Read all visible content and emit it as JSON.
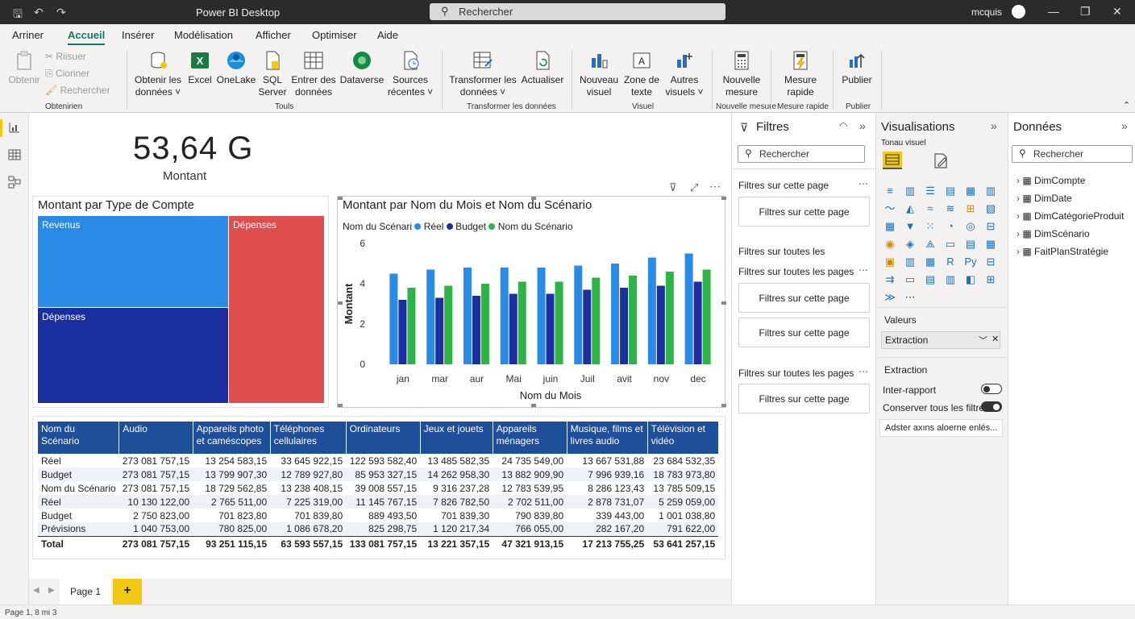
{
  "titlebar": {
    "app_title": "Power BI Desktop",
    "search_placeholder": "Rechercher",
    "user": "mcquis"
  },
  "menu": [
    "Arriner",
    "Accueil",
    "Insérer",
    "Modélisation",
    "Afficher",
    "Optimiser",
    "Aide"
  ],
  "ribbon": {
    "clipboard": {
      "paste": "Obtenir",
      "cut": "Riisuer",
      "copy": "Cioriner",
      "format": "Rechercher",
      "group": "Obtenirien"
    },
    "data": [
      {
        "line1": "Obtenir les",
        "line2": "données ˅"
      },
      {
        "line1": "Excel",
        "line2": ""
      },
      {
        "line1": "OneLake",
        "line2": ""
      },
      {
        "line1": "SQL",
        "line2": "Server"
      },
      {
        "line1": "Entrer des",
        "line2": "données"
      },
      {
        "line1": "Dataverse",
        "line2": ""
      },
      {
        "line1": "Sources",
        "line2": "récentes ˅"
      }
    ],
    "data_group": "Touls",
    "transform": [
      {
        "line1": "Transformer les",
        "line2": "données ˅"
      },
      {
        "line1": "Actualiser",
        "line2": ""
      }
    ],
    "transform_group": "Transformer les données",
    "visuals": [
      {
        "line1": "Nouveau",
        "line2": "visuel"
      },
      {
        "line1": "Zone de",
        "line2": "texte"
      },
      {
        "line1": "Autres",
        "line2": "visuels ˅"
      }
    ],
    "visuals_group": "Visuel",
    "measure": {
      "line1": "Nouvelle",
      "line2": "mesure",
      "group": "Nouvelle mesure"
    },
    "quick": {
      "line1": "Mesure",
      "line2": "rapide",
      "group": "Mesure rapide"
    },
    "publish": {
      "line1": "Publier",
      "group": "Publier"
    }
  },
  "kpi": {
    "value": "53,64 G",
    "label": "Montant"
  },
  "treemap": {
    "title": "Montant par Type de Compte",
    "tiles": [
      {
        "label": "Revenus",
        "color": "#2a8be6"
      },
      {
        "label": "Dépenses",
        "color": "#e04d4f"
      },
      {
        "label": "Dépenses",
        "color": "#1b2fa0"
      }
    ]
  },
  "chart_data": {
    "type": "bar",
    "title": "Montant par Nom du Mois et Nom du Scénario",
    "legend_title": "Nom du Scénario",
    "xlabel": "Nom du Mois",
    "ylabel": "Montant",
    "ylim": [
      0,
      6
    ],
    "yticks": [
      "0",
      "2",
      "4",
      "6"
    ],
    "categories": [
      "jan",
      "mar",
      "aur",
      "Mai",
      "juin",
      "Juil",
      "avit",
      "nov",
      "dec"
    ],
    "series": [
      {
        "name": "Réel",
        "color": "#2a8be6",
        "values": [
          4.5,
          4.7,
          4.8,
          4.8,
          4.8,
          4.9,
          5.0,
          5.3,
          5.5
        ]
      },
      {
        "name": "Budget",
        "color": "#1b2fa0",
        "values": [
          3.2,
          3.3,
          3.4,
          3.5,
          3.5,
          3.7,
          3.8,
          3.9,
          4.1
        ]
      },
      {
        "name": "Nom du Scénario",
        "color": "#2db446",
        "values": [
          3.8,
          3.9,
          4.0,
          4.1,
          4.1,
          4.3,
          4.4,
          4.6,
          4.7
        ]
      }
    ]
  },
  "table": {
    "headers": [
      "Nom du Scénario",
      "Audio",
      "Appareils photo et caméscopes",
      "Téléphones cellulaires",
      "Ordinateurs",
      "Jeux et jouets",
      "Appareils ménagers",
      "Musique, films et livres audio",
      "Télévision et vidéo"
    ],
    "rows": [
      [
        "Réel",
        "273 081 757,15",
        "13 254 583,15",
        "33 645 922,15",
        "122 593 582,40",
        "13 485 582,35",
        "24 735 549,00",
        "13 667 531,88",
        "23 684 532,35"
      ],
      [
        "Budget",
        "273 081 757,15",
        "13 799 907,30",
        "12 789 927,80",
        "85 953 327,15",
        "14 262 958,30",
        "13 882 909,90",
        "7 996 939,16",
        "18 783 973,80"
      ],
      [
        "Nom du Scénario",
        "273 081 757,15",
        "18 729 562,85",
        "13 238 408,15",
        "39 008 557,15",
        "9 316 237,28",
        "12 783 539,95",
        "8 286 123,43",
        "13 785 509,15"
      ],
      [
        "Réel",
        "10 130 122,00",
        "2 765 511,00",
        "7 225 319,00",
        "11 145 767,15",
        "7 826 782,50",
        "2 702 511,00",
        "2 878 731,07",
        "5 259 059,00"
      ],
      [
        "Budget",
        "2 750 823,00",
        "701 823,80",
        "701 839,80",
        "889 493,50",
        "701 839,30",
        "790 839,80",
        "339 443,00",
        "1 001 038,80"
      ],
      [
        "Prévisions",
        "1 040 753,00",
        "780 825,00",
        "1 086 678,20",
        "825 298,75",
        "1 120 217,34",
        "766 055,00",
        "282 167,20",
        "791 622,00"
      ]
    ],
    "total": [
      "Total",
      "273 081 757,15",
      "93 251 115,15",
      "63 593 557,15",
      "133 081 757,15",
      "13 221 357,15",
      "47 321 913,15",
      "17 213 755,25",
      "53 641 257,15"
    ]
  },
  "filters": {
    "title": "Filtres",
    "search": "Rechercher",
    "this_page_label": "Filtres sur cette page",
    "card": "Filtres sur cette page",
    "all_pages_short": "Filtres sur toutes les",
    "all_pages": "Filtres sur toutes les pages",
    "all_pages2": "Filtres sur toutes les pages"
  },
  "viz": {
    "title": "Visualisations",
    "subtitle": "Tonau visuel",
    "values_label": "Valeurs",
    "field": "Extraction",
    "section": "Extraction",
    "toggle1": "Inter-rapport",
    "toggle2": "Conserver tous les filtres",
    "button": "Adster axıns aloerne enlés..."
  },
  "data_pane": {
    "title": "Données",
    "search": "Rechercher",
    "tables": [
      "DimCompte",
      "DimDate",
      "DimCatégorieProduit",
      "DimScénario",
      "FaitPlanStratégie"
    ]
  },
  "pages": {
    "tab": "Page 1",
    "add": "+"
  },
  "status": "Page 1, 8 mi 3"
}
